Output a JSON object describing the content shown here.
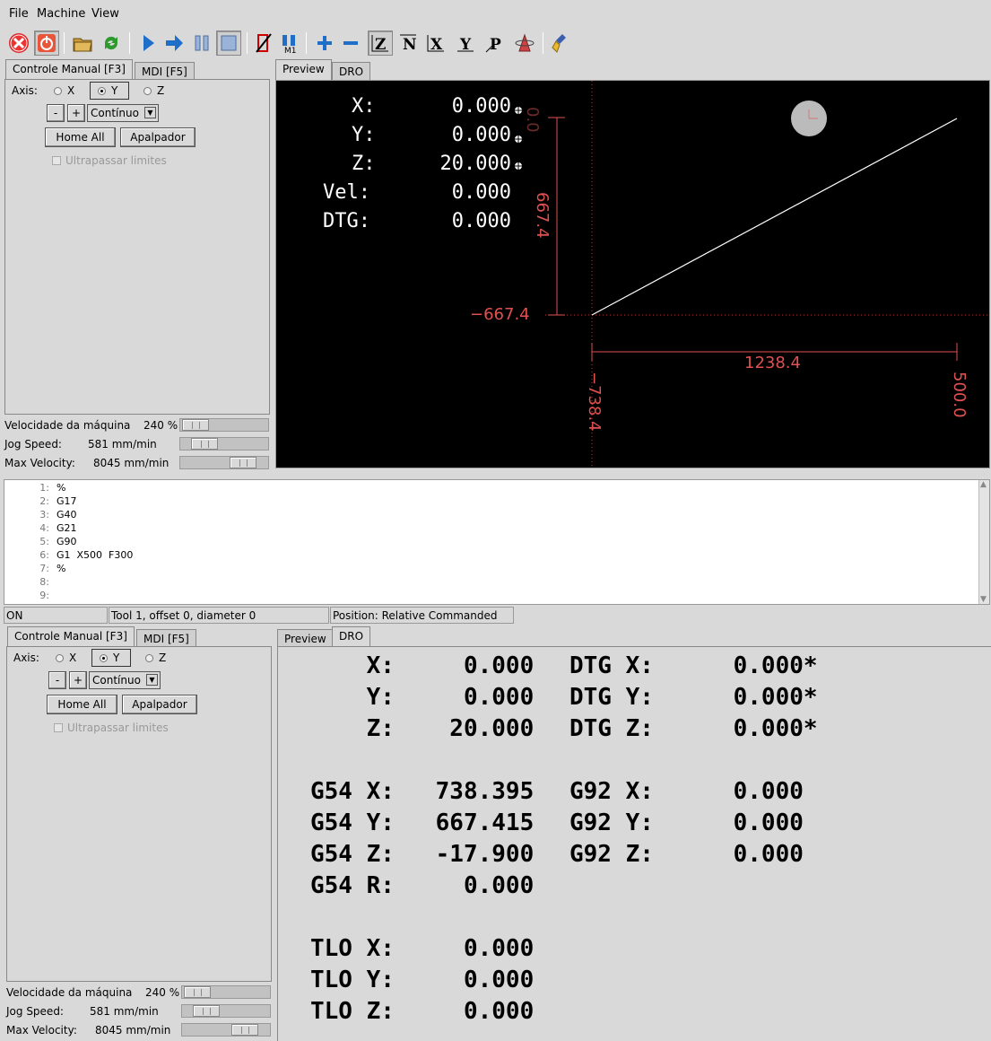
{
  "menu": [
    "File",
    "Machine",
    "View"
  ],
  "toolbar_icons": [
    "estop-icon",
    "power-icon",
    "open-file-icon",
    "reload-icon",
    "run-icon",
    "step-icon",
    "pause-icon",
    "stop-icon",
    "block-delete-icon",
    "optional-stop-icon",
    "zoom-in-icon",
    "zoom-out-icon",
    "view-z-icon",
    "view-z2-icon",
    "view-x-icon",
    "view-y-icon",
    "view-p-icon",
    "rotate-icon",
    "clear-live-plot-icon"
  ],
  "top": {
    "tabs": [
      "Controle Manual [F3]",
      "MDI [F5]"
    ],
    "preview_tabs": [
      "Preview",
      "DRO"
    ],
    "axis_label": "Axis:",
    "axes": [
      "X",
      "Y",
      "Z"
    ],
    "minus": "-",
    "plus": "+",
    "jog_mode": "Contínuo",
    "home_all": "Home All",
    "apalpador": "Apalpador",
    "override_limits": "Ultrapassar limites",
    "feed_label": "Velocidade da máquina",
    "feed_value": "240 %",
    "jog_label": "Jog Speed:",
    "jog_value": "581 mm/min",
    "maxvel_label": "Max Velocity:",
    "maxvel_value": "8045 mm/min",
    "feed_level": 0.08,
    "jog_level": 0.2,
    "maxvel_level": 0.7
  },
  "preview": {
    "rows": [
      {
        "label": "X:",
        "value": "0.000"
      },
      {
        "label": "Y:",
        "value": "0.000"
      },
      {
        "label": "Z:",
        "value": "20.000"
      },
      {
        "label": "Vel:",
        "value": "0.000"
      },
      {
        "label": "DTG:",
        "value": "0.000"
      }
    ],
    "dim_y_top": "0.0",
    "dim_y_span": "667.4",
    "dim_y_min": "−667.4",
    "dim_x_span": "1238.4",
    "dim_x_min": "−738.4",
    "dim_x_max": "500.0"
  },
  "gcode": [
    {
      "n": "1:",
      "t": "%"
    },
    {
      "n": "2:",
      "t": "G17"
    },
    {
      "n": "3:",
      "t": "G40"
    },
    {
      "n": "4:",
      "t": "G21"
    },
    {
      "n": "5:",
      "t": "G90"
    },
    {
      "n": "6:",
      "t": "G1  X500  F300"
    },
    {
      "n": "7:",
      "t": "%"
    },
    {
      "n": "8:",
      "t": ""
    },
    {
      "n": "9:",
      "t": ""
    }
  ],
  "status": {
    "state": "ON",
    "tool": "Tool 1, offset 0, diameter 0",
    "position": "Position: Relative Commanded"
  },
  "dro": {
    "rows": [
      {
        "a": "    X:",
        "v": "   0.000",
        "b": "DTG X:",
        "w": "    0.000*"
      },
      {
        "a": "    Y:",
        "v": "   0.000",
        "b": "DTG Y:",
        "w": "    0.000*"
      },
      {
        "a": "    Z:",
        "v": "  20.000",
        "b": "DTG Z:",
        "w": "    0.000*"
      },
      {
        "a": "G54 X:",
        "v": " 738.395",
        "b": "G92 X:",
        "w": "    0.000"
      },
      {
        "a": "G54 Y:",
        "v": " 667.415",
        "b": "G92 Y:",
        "w": "    0.000"
      },
      {
        "a": "G54 Z:",
        "v": " -17.900",
        "b": "G92 Z:",
        "w": "    0.000"
      },
      {
        "a": "G54 R:",
        "v": "   0.000",
        "b": "",
        "w": ""
      },
      {
        "a": "TLO X:",
        "v": "   0.000",
        "b": "",
        "w": ""
      },
      {
        "a": "TLO Y:",
        "v": "   0.000",
        "b": "",
        "w": ""
      },
      {
        "a": "TLO Z:",
        "v": "   0.000",
        "b": "",
        "w": ""
      }
    ]
  },
  "colors": {
    "dimension": "#e05050",
    "path": "#ffffff",
    "background": "#000000"
  }
}
